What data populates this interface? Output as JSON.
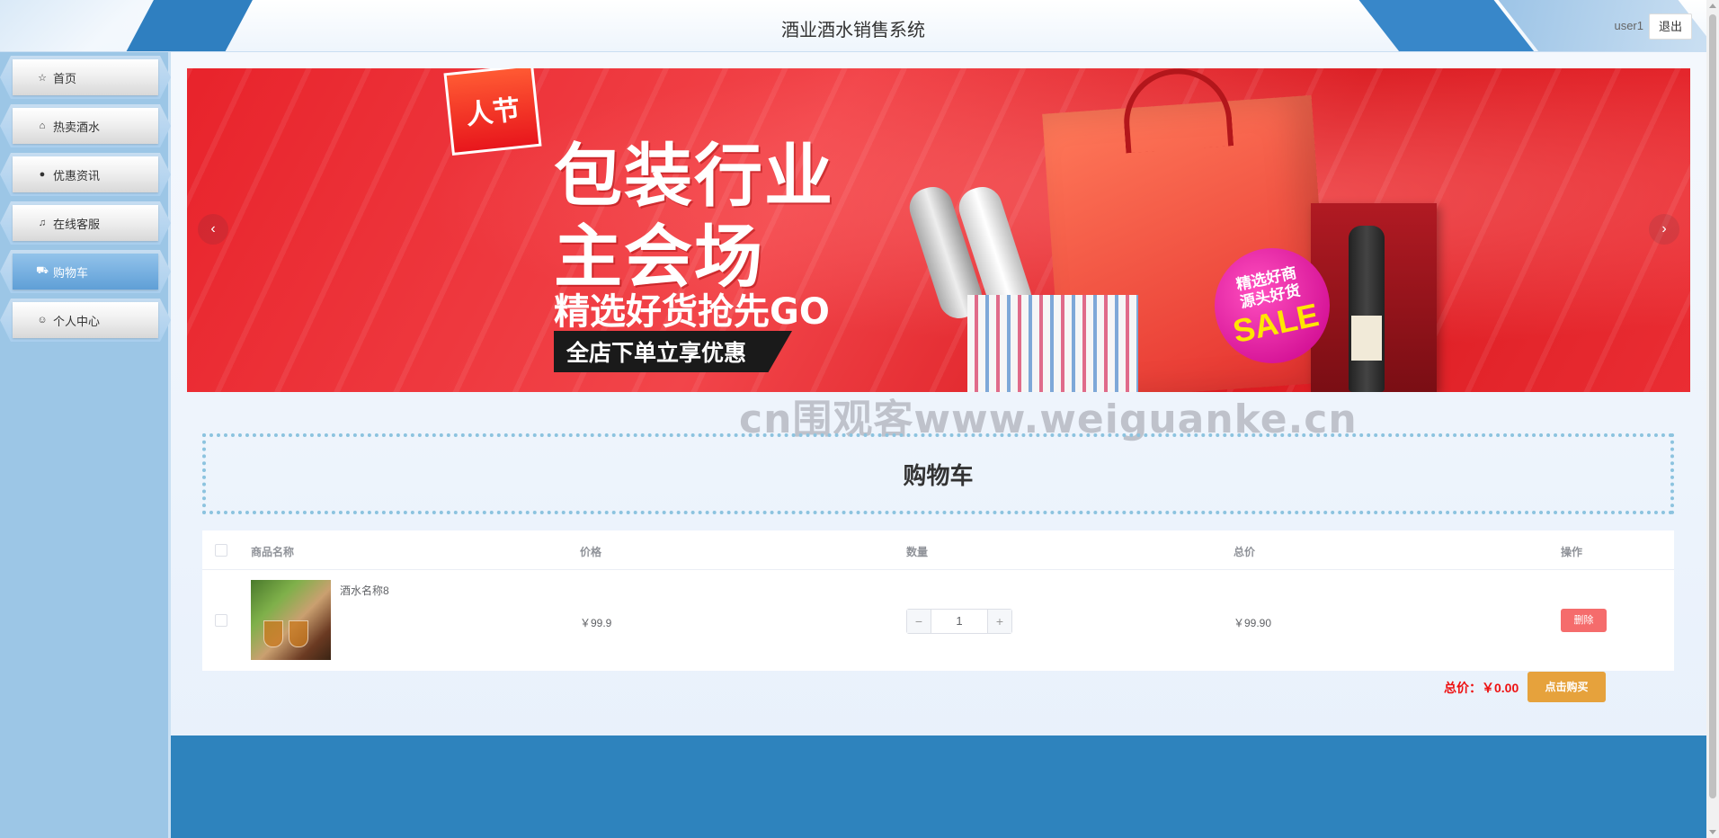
{
  "header": {
    "title": "酒业酒水销售系统",
    "username": "user1",
    "logout_label": "退出"
  },
  "sidebar": {
    "items": [
      {
        "label": "首页",
        "icon": "star-icon",
        "glyph": "☆",
        "active": false
      },
      {
        "label": "热卖酒水",
        "icon": "shopping-bag-icon",
        "glyph": "⌂",
        "active": false
      },
      {
        "label": "优惠资讯",
        "icon": "info-circle-icon",
        "glyph": "●",
        "active": false
      },
      {
        "label": "在线客服",
        "icon": "headset-icon",
        "glyph": "♫",
        "active": false
      },
      {
        "label": "购物车",
        "icon": "cart-icon",
        "glyph": "⛟",
        "active": true
      },
      {
        "label": "个人中心",
        "icon": "user-icon",
        "glyph": "☺",
        "active": false
      }
    ]
  },
  "banner": {
    "badge_text": "人节",
    "headline_1": "包装行业",
    "headline_2": "主会场",
    "subline": "精选好货抢先GO",
    "tagline": "全店下单立享优惠",
    "sale_line_1": "精选好商",
    "sale_line_2": "源头好货",
    "sale_word": "SALE",
    "prev_glyph": "‹",
    "next_glyph": "›"
  },
  "watermark": "cn围观客www.weiguanke.cn",
  "section_title": "购物车",
  "cart": {
    "columns": {
      "name": "商品名称",
      "price": "价格",
      "quantity": "数量",
      "subtotal": "总价",
      "actions": "操作"
    },
    "rows": [
      {
        "name": "酒水名称8",
        "price": "￥99.9",
        "quantity": "1",
        "subtotal": "￥99.90",
        "delete_label": "删除"
      }
    ],
    "stepper_minus": "−",
    "stepper_plus": "+",
    "total_text": "总价：￥0.00",
    "buy_label": "点击购买"
  },
  "colors": {
    "sidebar_bg": "#9cc6e6",
    "footer_bg": "#2e83bd",
    "delete_button": "#f56c6c",
    "buy_button": "#e6a23c",
    "total_text": "#ee1111"
  }
}
